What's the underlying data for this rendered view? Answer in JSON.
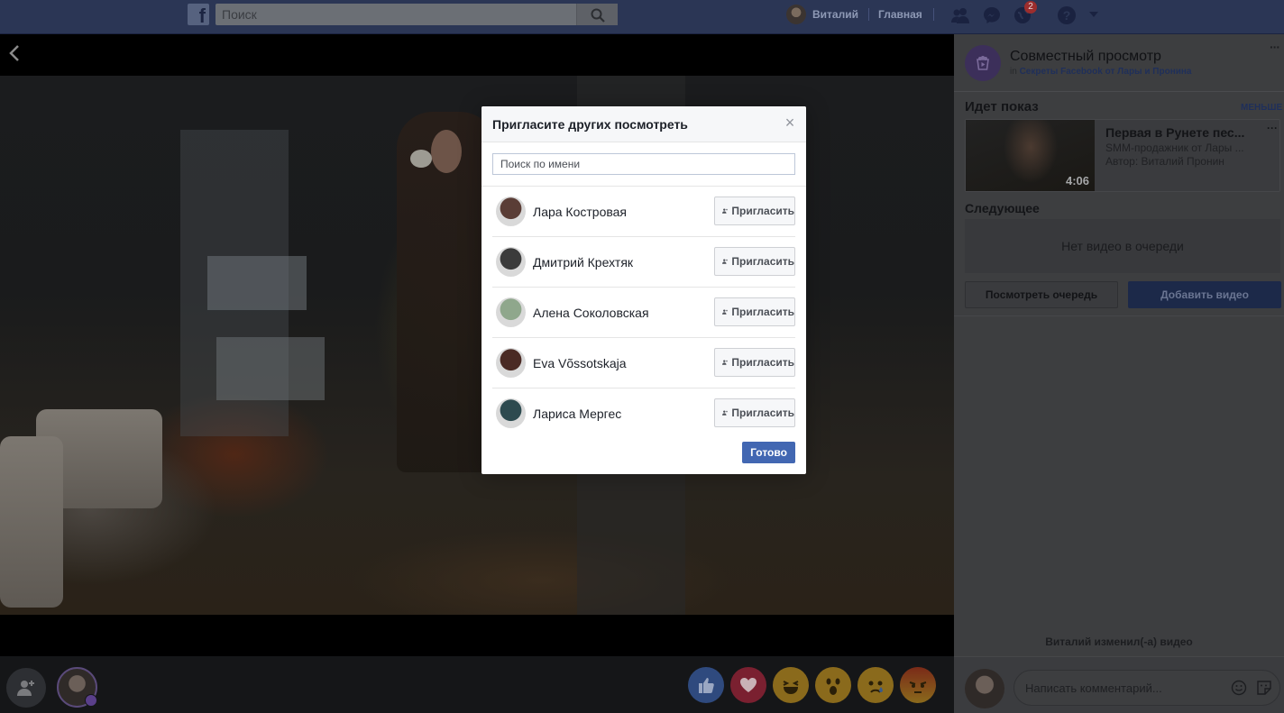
{
  "topbar": {
    "logo": "f",
    "search_placeholder": "Поиск",
    "user_name": "Виталий",
    "home_label": "Главная",
    "notifications_badge": "2"
  },
  "panel": {
    "title": "Совместный просмотр",
    "sub_prefix": "in",
    "sub_group": "Секреты Facebook от Лары и Пронина",
    "more_dots": "···",
    "now_playing_label": "Идет показ",
    "less_label": "МЕНЬШЕ",
    "video": {
      "title": "Первая в Рунете пес...",
      "subtitle": "SMM-продажник от Лары ...",
      "author": "Автор: Виталий Пронин",
      "duration": "4:06"
    },
    "next_label": "Следующее",
    "queue_empty": "Нет видео в очереди",
    "view_queue_button": "Посмотреть очередь",
    "add_video_button": "Добавить видео",
    "changed_text": "Виталий изменил(-а) видео",
    "comment_placeholder": "Написать комментарий..."
  },
  "modal": {
    "title": "Пригласите других посмотреть",
    "close": "×",
    "search_placeholder": "Поиск по имени",
    "invite_label": "Пригласить",
    "done_label": "Готово",
    "people": [
      {
        "name": "Лара Костровая",
        "avatar_color": "#5a3d36"
      },
      {
        "name": "Дмитрий Крехтяк",
        "avatar_color": "#3b3b3b"
      },
      {
        "name": "Алена Соколовская",
        "avatar_color": "#8fa78c"
      },
      {
        "name": "Eva Võssotskaja",
        "avatar_color": "#4a2a24"
      },
      {
        "name": "Лариса Мергес",
        "avatar_color": "#2d4a4f"
      }
    ]
  },
  "colors": {
    "accent": "#4267b2",
    "topbar": "#2b3655"
  }
}
